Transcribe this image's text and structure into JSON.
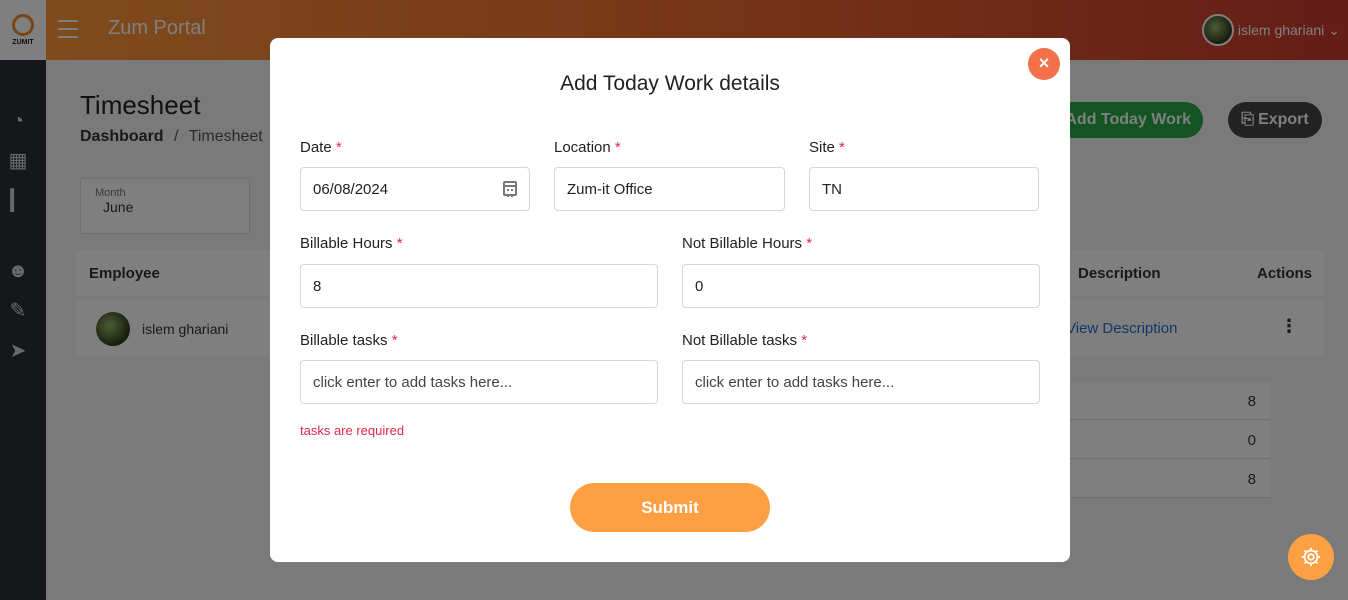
{
  "app": {
    "logo_text": "ZUMIT",
    "portal_title": "Zum Portal",
    "user_name": "islem ghariani"
  },
  "page": {
    "title": "Timesheet",
    "breadcrumb_root": "Dashboard",
    "breadcrumb_sep": "/",
    "breadcrumb_current": "Timesheet",
    "add_button": "Add Today Work",
    "export_button": "Export",
    "month_label": "Month",
    "month_value": "June"
  },
  "table": {
    "headers": [
      "Employee",
      "Description",
      "Actions"
    ],
    "row": {
      "name": "islem ghariani",
      "view_description": "View Description"
    },
    "summary": [
      "8",
      "0",
      "8"
    ]
  },
  "modal": {
    "title": "Add Today Work details",
    "close_symbol": "×",
    "required_mark": "*",
    "date": {
      "label": "Date",
      "value": "06/08/2024"
    },
    "location": {
      "label": "Location",
      "value": "Zum-it Office"
    },
    "site": {
      "label": "Site",
      "value": "TN"
    },
    "billable_hours": {
      "label": "Billable Hours",
      "value": "8"
    },
    "not_billable_hours": {
      "label": "Not Billable Hours",
      "value": "0"
    },
    "billable_tasks": {
      "label": "Billable tasks",
      "placeholder": "click enter to add tasks here..."
    },
    "not_billable_tasks": {
      "label": "Not Billable tasks",
      "placeholder": "click enter to add tasks here..."
    },
    "error": "tasks are required",
    "submit": "Submit"
  },
  "colors": {
    "accent": "#ff9f43",
    "close": "#f3704a",
    "required": "#e0294a",
    "add_button": "#28a745"
  }
}
